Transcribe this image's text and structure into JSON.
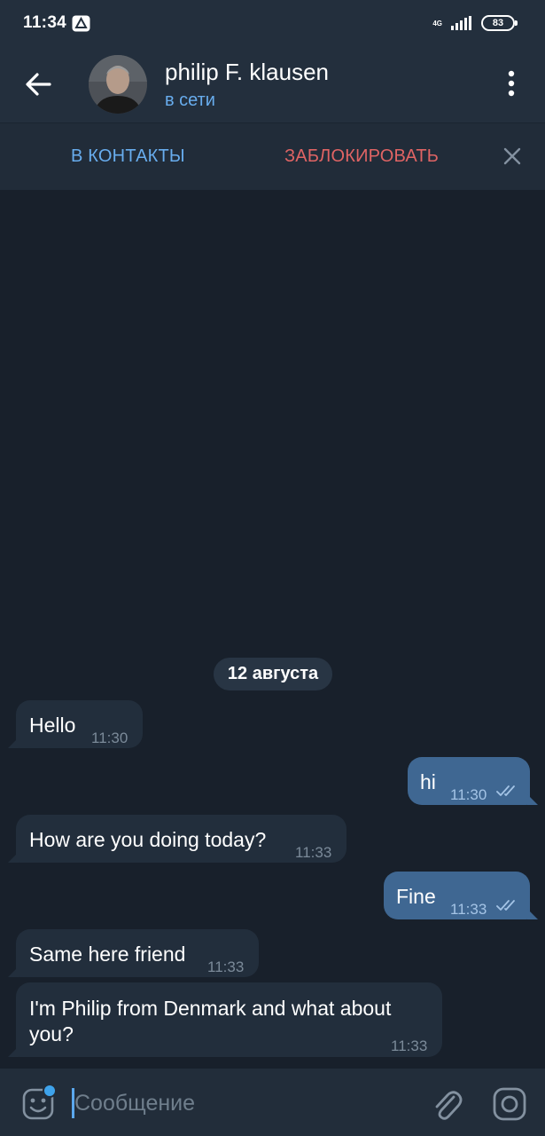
{
  "status_bar": {
    "time": "11:34",
    "network": "4G",
    "battery": "83"
  },
  "header": {
    "contact_name": "philip F. klausen",
    "status": "в сети"
  },
  "action_bar": {
    "add_contact": "В КОНТАКТЫ",
    "block": "ЗАБЛОКИРОВАТЬ"
  },
  "chat": {
    "date": "12 августа",
    "messages": [
      {
        "direction": "in",
        "text": "Hello",
        "time": "11:30"
      },
      {
        "direction": "out",
        "text": "hi",
        "time": "11:30",
        "read": true
      },
      {
        "direction": "in",
        "text": "How are you doing today?",
        "time": "11:33"
      },
      {
        "direction": "out",
        "text": "Fine",
        "time": "11:33",
        "read": true
      },
      {
        "direction": "in",
        "text": "Same here friend",
        "time": "11:33"
      },
      {
        "direction": "in",
        "text_line1": "I'm Philip from Denmark and what about",
        "text_line2": "you?",
        "time": "11:33"
      }
    ]
  },
  "input": {
    "placeholder": "Сообщение",
    "value": ""
  },
  "colors": {
    "background": "#18202b",
    "header": "#232f3d",
    "incoming_bubble": "#222e3c",
    "outgoing_bubble": "#3f6792",
    "accent": "#68adee",
    "danger": "#e06464"
  },
  "icons": [
    "back-arrow-icon",
    "more-vertical-icon",
    "close-icon",
    "double-check-icon",
    "emoji-icon",
    "attach-icon",
    "camera-icon"
  ]
}
